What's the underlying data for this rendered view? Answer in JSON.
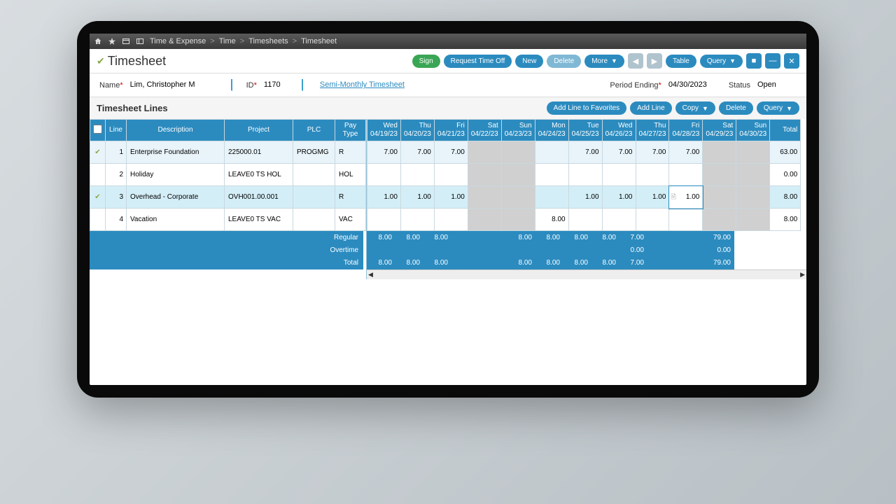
{
  "breadcrumb": {
    "items": [
      "Time & Expense",
      "Time",
      "Timesheets",
      "Timesheet"
    ]
  },
  "page": {
    "title": "Timesheet"
  },
  "actions": {
    "sign": "Sign",
    "rto": "Request Time Off",
    "new": "New",
    "delete": "Delete",
    "more": "More",
    "table": "Table",
    "query": "Query"
  },
  "form": {
    "name_label": "Name",
    "name": "Lim, Christopher M",
    "id_label": "ID",
    "id": "1170",
    "ts_type": "Semi-Monthly Timesheet",
    "pe_label": "Period Ending",
    "pe": "04/30/2023",
    "status_label": "Status",
    "status": "Open"
  },
  "lines": {
    "title": "Timesheet Lines",
    "actions": {
      "fav": "Add Line to Favorites",
      "add": "Add Line",
      "copy": "Copy",
      "del": "Delete",
      "query": "Query"
    },
    "cols": {
      "line": "Line",
      "desc": "Description",
      "proj": "Project",
      "plc": "PLC",
      "pt": "Pay Type",
      "total": "Total"
    },
    "days": [
      {
        "dow": "Wed",
        "date": "04/19/23"
      },
      {
        "dow": "Thu",
        "date": "04/20/23"
      },
      {
        "dow": "Fri",
        "date": "04/21/23"
      },
      {
        "dow": "Sat",
        "date": "04/22/23"
      },
      {
        "dow": "Sun",
        "date": "04/23/23"
      },
      {
        "dow": "Mon",
        "date": "04/24/23"
      },
      {
        "dow": "Tue",
        "date": "04/25/23"
      },
      {
        "dow": "Wed",
        "date": "04/26/23"
      },
      {
        "dow": "Thu",
        "date": "04/27/23"
      },
      {
        "dow": "Fri",
        "date": "04/28/23"
      },
      {
        "dow": "Sat",
        "date": "04/29/23"
      },
      {
        "dow": "Sun",
        "date": "04/30/23"
      }
    ],
    "rows": [
      {
        "chk": true,
        "n": "1",
        "desc": "Enterprise Foundation",
        "proj": "225000.01",
        "plc": "PROGMG",
        "pt": "R",
        "d": [
          "7.00",
          "7.00",
          "7.00",
          "",
          "",
          "",
          "7.00",
          "7.00",
          "7.00",
          "7.00",
          "",
          ""
        ],
        "total": "63.00"
      },
      {
        "chk": false,
        "n": "2",
        "desc": "Holiday",
        "proj": "LEAVE0 TS HOL",
        "plc": "",
        "pt": "HOL",
        "d": [
          "",
          "",
          "",
          "",
          "",
          "",
          "",
          "",
          "",
          "",
          "",
          ""
        ],
        "total": "0.00"
      },
      {
        "chk": true,
        "n": "3",
        "desc": "Overhead - Corporate",
        "proj": "OVH001.00.001",
        "plc": "",
        "pt": "R",
        "d": [
          "1.00",
          "1.00",
          "1.00",
          "",
          "",
          "",
          "1.00",
          "1.00",
          "1.00",
          "1.00",
          "",
          ""
        ],
        "total": "8.00",
        "sel": true,
        "active_day": 9,
        "active_val": "1.00"
      },
      {
        "chk": false,
        "n": "4",
        "desc": "Vacation",
        "proj": "LEAVE0 TS VAC",
        "plc": "",
        "pt": "VAC",
        "d": [
          "",
          "",
          "",
          "",
          "",
          "8.00",
          "",
          "",
          "",
          "",
          "",
          ""
        ],
        "total": "8.00"
      }
    ],
    "totals": {
      "reg_label": "Regular",
      "ot_label": "Overtime",
      "tot_label": "Total",
      "reg": [
        "8.00",
        "8.00",
        "8.00",
        "",
        "",
        "8.00",
        "8.00",
        "8.00",
        "8.00",
        "7.00",
        "",
        ""
      ],
      "ot": [
        "",
        "",
        "",
        "",
        "",
        "",
        "",
        "",
        "",
        "0.00",
        "",
        ""
      ],
      "tot": [
        "8.00",
        "8.00",
        "8.00",
        "",
        "",
        "8.00",
        "8.00",
        "8.00",
        "8.00",
        "7.00",
        "",
        ""
      ],
      "reg_total": "79.00",
      "ot_total": "0.00",
      "tot_total": "79.00"
    }
  }
}
